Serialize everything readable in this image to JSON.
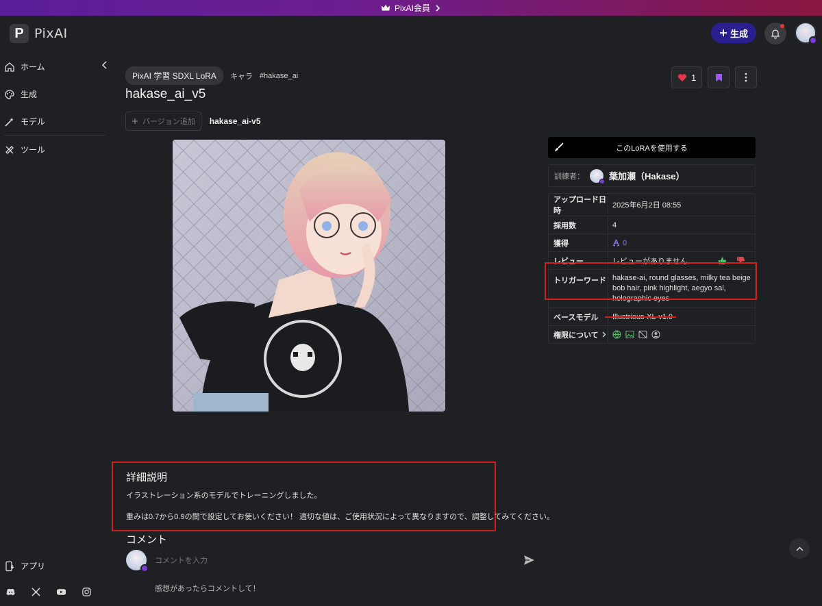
{
  "banner": {
    "text": "PixAI会員",
    "icon": "crown-icon"
  },
  "app": {
    "logo_letter": "P",
    "name": "PixAI"
  },
  "header": {
    "generate_label": "生成"
  },
  "sidebar": {
    "items": [
      {
        "label": "ホーム",
        "icon": "home-icon"
      },
      {
        "label": "生成",
        "icon": "palette-icon"
      },
      {
        "label": "モデル",
        "icon": "magic-wand-icon"
      },
      {
        "label": "ツール",
        "icon": "tools-icon"
      }
    ],
    "app_label": "アプリ"
  },
  "model": {
    "tags": [
      "PixAI 学習 SDXL LoRA",
      "キャラ",
      "#hakase_ai"
    ],
    "title": "hakase_ai_v5",
    "like_count": "1",
    "add_version_label": "バージョン追加",
    "version_name": "hakase_ai-v5"
  },
  "panel": {
    "use_lora_label": "このLoRAを使用する",
    "trainer_label": "訓練者：",
    "trainer_name": "葉加瀬（Hakase）",
    "rows": {
      "upload_key": "アップロード日時",
      "upload_val": "2025年6月2日 08:55",
      "adopt_key": "採用数",
      "adopt_val": "4",
      "earn_key": "獲得",
      "earn_val": "0",
      "review_key": "レビュー",
      "review_val": "レビューがありません",
      "trigger_key": "トリガーワード",
      "trigger_val": "hakase-ai, round glasses, milky tea beige bob hair, pink highlight, aegyo sal, holographic eyes",
      "base_key": "ベースモデル",
      "base_val": "Illustrious-XL-v1.0",
      "perm_key": "権限について"
    }
  },
  "description": {
    "title": "詳細説明",
    "line1": "イラストレーション系のモデルでトレーニングしました。",
    "line2": "重みは0.7から0.9の間で設定してお使いください！ 適切な値は、ご使用状況によって異なりますので、調整してみてください。"
  },
  "comments": {
    "title": "コメント",
    "placeholder": "コメントを入力",
    "feedback_prompt": "感想があったらコメントして！"
  },
  "colors": {
    "accent": "#2a1f8e",
    "highlight": "#d41d1d",
    "banner_start": "#5b1f9a",
    "banner_end": "#8a1740"
  }
}
